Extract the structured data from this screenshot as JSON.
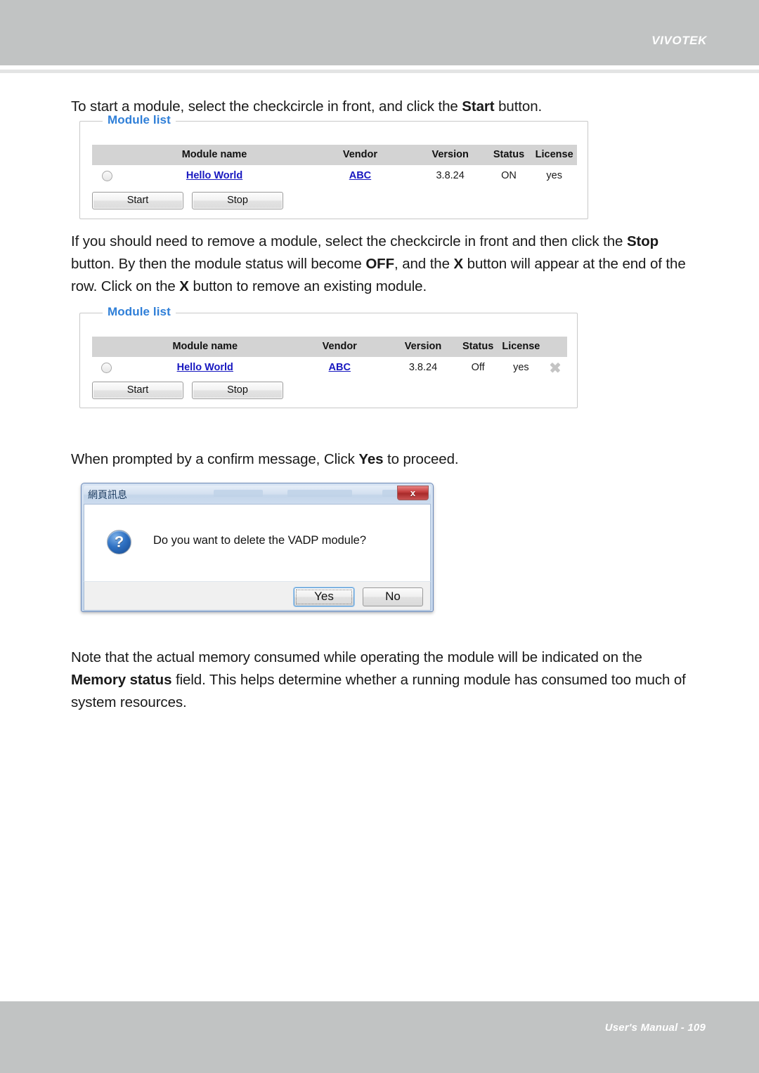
{
  "header": {
    "brand": "VIVOTEK"
  },
  "footer": {
    "manual_label": "User's Manual -  109"
  },
  "paragraphs": {
    "p1_before": "To start a module, select the checkcircle in front, and click the ",
    "p1_bold": "Start",
    "p1_after": " button.",
    "p2_a": "If you should need to remove a module, select the checkcircle in front and then click the ",
    "p2_b1": "Stop",
    "p2_b": " button. By then the module status will become ",
    "p2_b2": "OFF",
    "p2_c": ", and the ",
    "p2_b3": "X",
    "p2_d": " button will appear at the end of the row. Click on the ",
    "p2_b4": "X",
    "p2_e": " button to remove an existing module.",
    "p3_a": "When prompted by a confirm message, Click ",
    "p3_b": "Yes",
    "p3_c": " to proceed.",
    "p4_a": "Note that the actual memory consumed while operating the module will be indicated on the ",
    "p4_b": "Memory status",
    "p4_c": " field. This helps determine whether a running module has consumed too much of system resources."
  },
  "module_list_1": {
    "legend": "Module list",
    "columns": [
      "",
      "Module name",
      "Vendor",
      "Version",
      "Status",
      "License"
    ],
    "rows": [
      {
        "name": "Hello World",
        "vendor": "ABC",
        "version": "3.8.24",
        "status": "ON",
        "license": "yes"
      }
    ],
    "buttons": {
      "start": "Start",
      "stop": "Stop"
    }
  },
  "module_list_2": {
    "legend": "Module list",
    "columns": [
      "",
      "Module name",
      "Vendor",
      "Version",
      "Status",
      "License",
      ""
    ],
    "rows": [
      {
        "name": "Hello World",
        "vendor": "ABC",
        "version": "3.8.24",
        "status": "Off",
        "license": "yes",
        "remove_icon": "close-x-icon"
      }
    ],
    "buttons": {
      "start": "Start",
      "stop": "Stop"
    }
  },
  "confirm_dialog": {
    "title": "網頁訊息",
    "close_label": "x",
    "icon": "question-mark-icon",
    "message": "Do you want to delete the VADP module?",
    "yes_label": "Yes",
    "no_label": "No"
  },
  "colors": {
    "band_gray": "#c1c3c3",
    "legend_blue": "#2f7fd8",
    "link_blue": "#1818c0",
    "table_header_gray": "#d3d3d3"
  }
}
